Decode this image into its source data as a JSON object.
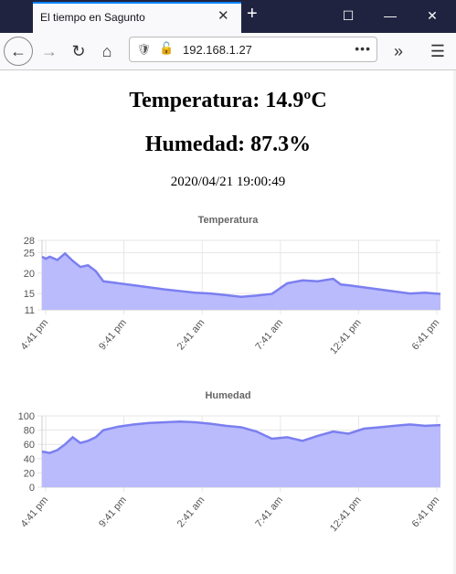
{
  "browser": {
    "tab_title": "El tiempo en Sagunto",
    "url": "192.168.1.27",
    "new_tab": "+",
    "url_menu": "•••",
    "overflow": "»",
    "menu": "☰"
  },
  "page": {
    "temperature_heading": "Temperatura: 14.9ºC",
    "humidity_heading": "Humedad: 87.3%",
    "timestamp": "2020/04/21 19:00:49"
  },
  "chart_data": [
    {
      "type": "area",
      "title": "Temperatura",
      "ylim": [
        11,
        28
      ],
      "yticks": [
        11,
        15,
        20,
        25,
        28
      ],
      "xticks": [
        "4:41 pm",
        "9:41 pm",
        "2:41 am",
        "7:41 am",
        "12:41 pm",
        "6:41 pm"
      ],
      "grid": true,
      "color": "#7b7ff0",
      "fill": "#b9bbfc",
      "x": [
        0,
        0.25,
        0.5,
        1,
        1.5,
        2,
        2.5,
        3,
        3.5,
        4,
        5,
        6,
        7,
        8,
        9,
        10,
        11,
        12,
        13,
        14,
        15,
        16,
        17,
        18,
        19,
        19.5,
        20,
        21,
        22,
        23,
        24,
        25,
        26
      ],
      "values": [
        24,
        23.5,
        24,
        23.2,
        24.8,
        23.0,
        21.5,
        21.9,
        20.5,
        18.0,
        17.5,
        17.0,
        16.5,
        16.0,
        15.6,
        15.2,
        15.0,
        14.6,
        14.2,
        14.5,
        14.9,
        17.5,
        18.2,
        18.0,
        18.6,
        17.2,
        17.0,
        16.5,
        16.0,
        15.5,
        15.0,
        15.2,
        14.9
      ]
    },
    {
      "type": "area",
      "title": "Humedad",
      "ylim": [
        0,
        100
      ],
      "yticks": [
        0,
        20,
        40,
        60,
        80,
        100
      ],
      "xticks": [
        "4:41 pm",
        "9:41 pm",
        "2:41 am",
        "7:41 am",
        "12:41 pm",
        "6:41 pm"
      ],
      "grid": true,
      "color": "#7b7ff0",
      "fill": "#b9bbfc",
      "x": [
        0,
        0.5,
        1,
        1.5,
        2,
        2.5,
        3,
        3.5,
        4,
        5,
        6,
        7,
        8,
        9,
        10,
        11,
        12,
        13,
        14,
        15,
        16,
        17,
        18,
        19,
        20,
        21,
        22,
        23,
        24,
        25,
        26
      ],
      "values": [
        50,
        48,
        52,
        60,
        70,
        62,
        65,
        70,
        80,
        85,
        88,
        90,
        91,
        92,
        91,
        89,
        86,
        84,
        78,
        68,
        70,
        65,
        72,
        78,
        75,
        82,
        84,
        86,
        88,
        86,
        87
      ]
    }
  ]
}
